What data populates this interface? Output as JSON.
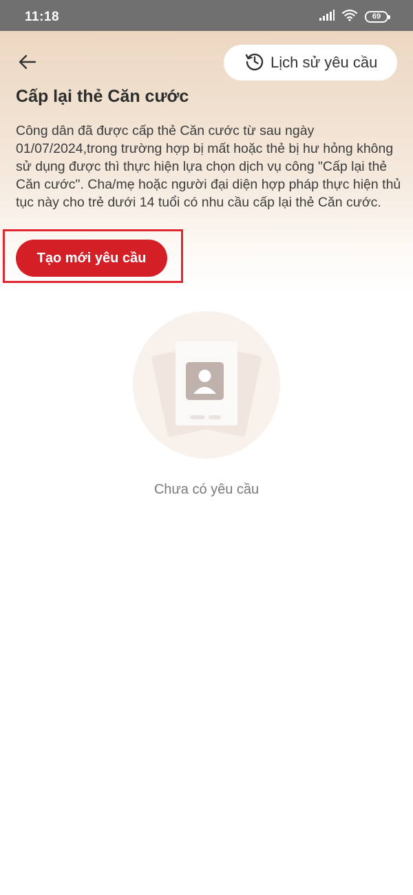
{
  "status_bar": {
    "time": "11:18",
    "battery": "69"
  },
  "header": {
    "history_label": "Lịch sử yêu cầu",
    "title": "Cấp lại thẻ Căn cước",
    "description": "Công dân đã được cấp thẻ Căn cước từ sau ngày 01/07/2024,trong trường hợp bị mất hoặc thẻ bị hư hỏng không sử dụng được thì thực hiện lựa chọn dịch vụ công \"Cấp lại thẻ Căn cước\". Cha/mẹ hoặc người đại diện hợp pháp thực hiện thủ tục này cho trẻ dưới 14 tuổi có nhu cầu cấp lại thẻ Căn cước."
  },
  "actions": {
    "create_label": "Tạo mới yêu cầu"
  },
  "empty_state": {
    "text": "Chưa có yêu cầu"
  },
  "icons": {
    "back": "arrow-left-icon",
    "history": "clock-history-icon",
    "empty": "id-card-icon",
    "signal": "signal-icon",
    "wifi": "wifi-icon",
    "battery": "battery-icon"
  },
  "colors": {
    "primary": "#d41f27",
    "highlight": "#e0252e",
    "header_gradient_top": "#ecd7c1",
    "status_bar": "#707070"
  }
}
